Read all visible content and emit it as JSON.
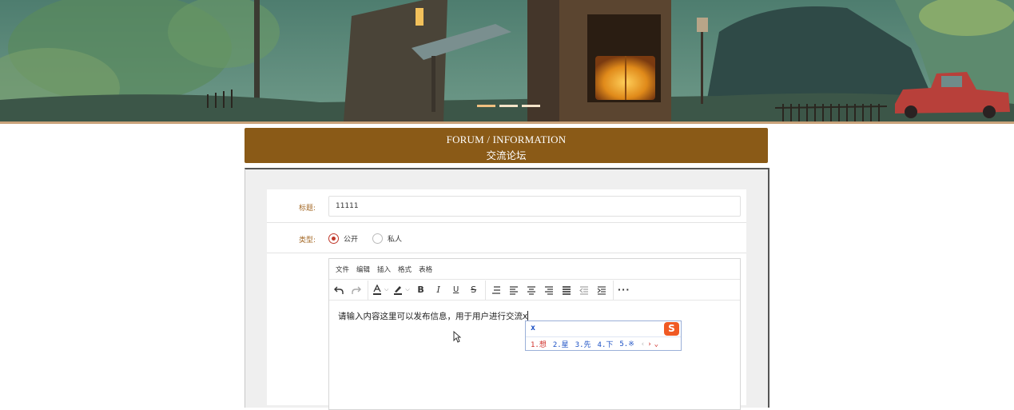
{
  "header": {
    "title_en": "FORUM / INFORMATION",
    "title_cn": "交流论坛"
  },
  "form": {
    "title_label": "标题:",
    "title_value": "11111",
    "type_label": "类型:",
    "type_options": [
      {
        "label": "公开",
        "checked": true
      },
      {
        "label": "私人",
        "checked": false
      }
    ]
  },
  "editor": {
    "menu": [
      "文件",
      "编辑",
      "插入",
      "格式",
      "表格"
    ],
    "content": "请输入内容这里可以发布信息，用于用户进行交流x"
  },
  "ime": {
    "input": "x",
    "candidates": [
      "1.想",
      "2.星",
      "3.先",
      "4.下",
      "5.※"
    ]
  },
  "colors": {
    "accent": "#8a5a17",
    "label": "#a56b2a",
    "radio_checked": "#c0392b"
  }
}
